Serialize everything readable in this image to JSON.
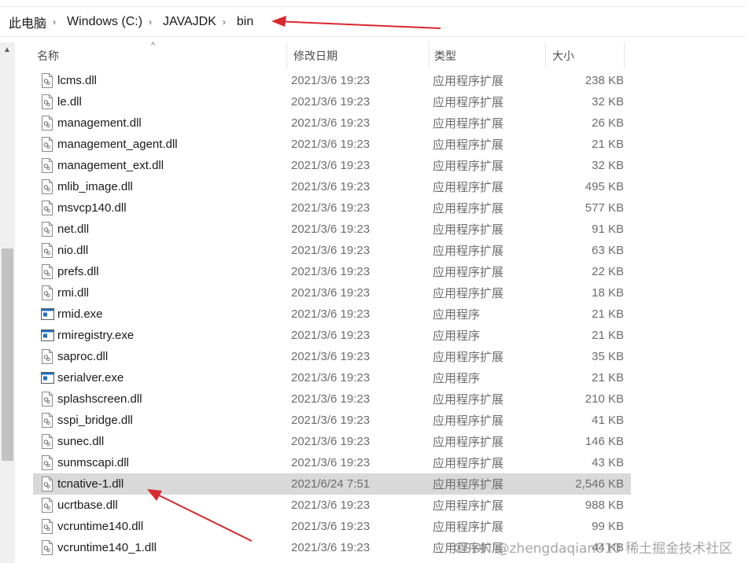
{
  "breadcrumb": {
    "items": [
      "此电脑",
      "Windows (C:)",
      "JAVAJDK",
      "bin"
    ],
    "separator": "›"
  },
  "columns": {
    "name": "名称",
    "date": "修改日期",
    "type": "类型",
    "size": "大小"
  },
  "icons": {
    "dll": "dll-file-icon",
    "exe": "exe-file-icon"
  },
  "files": [
    {
      "name": "lcms.dll",
      "date": "2021/3/6 19:23",
      "type": "应用程序扩展",
      "size": "238 KB",
      "kind": "dll"
    },
    {
      "name": "le.dll",
      "date": "2021/3/6 19:23",
      "type": "应用程序扩展",
      "size": "32 KB",
      "kind": "dll"
    },
    {
      "name": "management.dll",
      "date": "2021/3/6 19:23",
      "type": "应用程序扩展",
      "size": "26 KB",
      "kind": "dll"
    },
    {
      "name": "management_agent.dll",
      "date": "2021/3/6 19:23",
      "type": "应用程序扩展",
      "size": "21 KB",
      "kind": "dll"
    },
    {
      "name": "management_ext.dll",
      "date": "2021/3/6 19:23",
      "type": "应用程序扩展",
      "size": "32 KB",
      "kind": "dll"
    },
    {
      "name": "mlib_image.dll",
      "date": "2021/3/6 19:23",
      "type": "应用程序扩展",
      "size": "495 KB",
      "kind": "dll"
    },
    {
      "name": "msvcp140.dll",
      "date": "2021/3/6 19:23",
      "type": "应用程序扩展",
      "size": "577 KB",
      "kind": "dll"
    },
    {
      "name": "net.dll",
      "date": "2021/3/6 19:23",
      "type": "应用程序扩展",
      "size": "91 KB",
      "kind": "dll"
    },
    {
      "name": "nio.dll",
      "date": "2021/3/6 19:23",
      "type": "应用程序扩展",
      "size": "63 KB",
      "kind": "dll"
    },
    {
      "name": "prefs.dll",
      "date": "2021/3/6 19:23",
      "type": "应用程序扩展",
      "size": "22 KB",
      "kind": "dll"
    },
    {
      "name": "rmi.dll",
      "date": "2021/3/6 19:23",
      "type": "应用程序扩展",
      "size": "18 KB",
      "kind": "dll"
    },
    {
      "name": "rmid.exe",
      "date": "2021/3/6 19:23",
      "type": "应用程序",
      "size": "21 KB",
      "kind": "exe"
    },
    {
      "name": "rmiregistry.exe",
      "date": "2021/3/6 19:23",
      "type": "应用程序",
      "size": "21 KB",
      "kind": "exe"
    },
    {
      "name": "saproc.dll",
      "date": "2021/3/6 19:23",
      "type": "应用程序扩展",
      "size": "35 KB",
      "kind": "dll"
    },
    {
      "name": "serialver.exe",
      "date": "2021/3/6 19:23",
      "type": "应用程序",
      "size": "21 KB",
      "kind": "exe"
    },
    {
      "name": "splashscreen.dll",
      "date": "2021/3/6 19:23",
      "type": "应用程序扩展",
      "size": "210 KB",
      "kind": "dll"
    },
    {
      "name": "sspi_bridge.dll",
      "date": "2021/3/6 19:23",
      "type": "应用程序扩展",
      "size": "41 KB",
      "kind": "dll"
    },
    {
      "name": "sunec.dll",
      "date": "2021/3/6 19:23",
      "type": "应用程序扩展",
      "size": "146 KB",
      "kind": "dll"
    },
    {
      "name": "sunmscapi.dll",
      "date": "2021/3/6 19:23",
      "type": "应用程序扩展",
      "size": "43 KB",
      "kind": "dll"
    },
    {
      "name": "tcnative-1.dll",
      "date": "2021/6/24 7:51",
      "type": "应用程序扩展",
      "size": "2,546 KB",
      "kind": "dll",
      "selected": true
    },
    {
      "name": "ucrtbase.dll",
      "date": "2021/3/6 19:23",
      "type": "应用程序扩展",
      "size": "988 KB",
      "kind": "dll"
    },
    {
      "name": "vcruntime140.dll",
      "date": "2021/3/6 19:23",
      "type": "应用程序扩展",
      "size": "99 KB",
      "kind": "dll"
    },
    {
      "name": "vcruntime140_1.dll",
      "date": "2021/3/6 19:23",
      "type": "应用程序扩展",
      "size": "44 KB",
      "kind": "dll"
    }
  ],
  "watermark": "CSDN @zhengdaqian010  稀土掘金技术社区",
  "colors": {
    "selected_row": "#d9d9d9",
    "annotation_arrow": "#d9282f",
    "exe_icon_blue": "#1f6fc5"
  }
}
